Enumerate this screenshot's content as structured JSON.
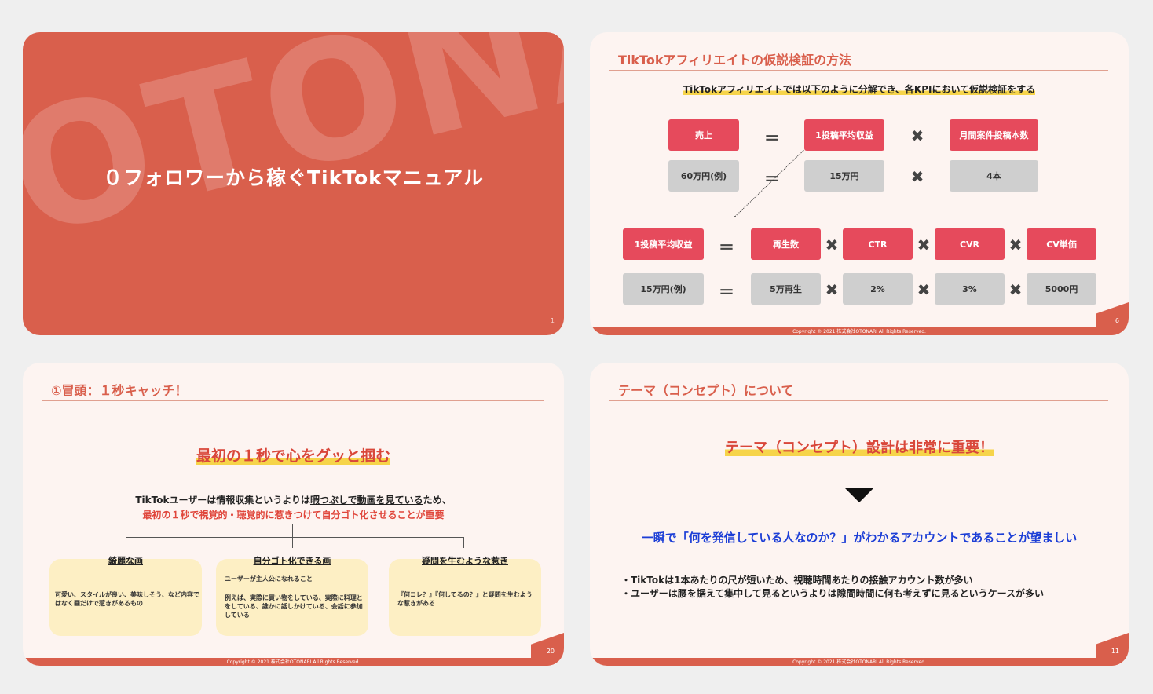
{
  "s1": {
    "watermark": "OTONARI",
    "title": "０フォロワーから稼ぐTikTokマニュアル",
    "page": "1"
  },
  "s2": {
    "title": "TikTokアフィリエイトの仮説検証の方法",
    "subtitle": "TikTokアフィリエイトでは以下のように分解でき、各KPIにおいて仮説検証をする",
    "row1": [
      "売上",
      "1投稿平均収益",
      "月間案件投稿本数"
    ],
    "row2": [
      "60万円(例)",
      "15万円",
      "4本"
    ],
    "row3": [
      "1投稿平均収益",
      "再生数",
      "CTR",
      "CVR",
      "CV単価"
    ],
    "row4": [
      "15万円(例)",
      "5万再生",
      "2%",
      "3%",
      "5000円"
    ],
    "equals": "＝",
    "times": "✖",
    "copyright": "Copyright © 2021 株式会社OTONARI All Rights Reserved.",
    "page": "6"
  },
  "s3": {
    "title": "①冒頭：１秒キャッチ！",
    "catch": "最初の１秒で心をグッと掴む",
    "line1_a": "TikTokユーザーは情報収集というよりは",
    "line1_u": "暇つぶしで動画を見ている",
    "line1_b": "ため、",
    "line2": "最初の１秒で視覚的・聴覚的に惹きつけて自分ゴト化させることが重要",
    "cards": [
      {
        "head": "綺麗な画",
        "text": "可愛い、スタイルが良い、美味しそう、など内容ではなく画だけで惹きがあるもの"
      },
      {
        "head": "自分ゴト化できる画",
        "text1": "ユーザーが主人公になれること",
        "text2": "例えば、実際に買い物をしている、実際に料理とをしている、誰かに話しかけている、会話に参加している"
      },
      {
        "head": "疑問を生むような惹き",
        "text": "『何コレ？』『何してるの？』と疑問を生むような惹きがある"
      }
    ],
    "copyright": "Copyright © 2021 株式会社OTONARI All Rights Reserved.",
    "page": "20"
  },
  "s4": {
    "title": "テーマ（コンセプト）について",
    "catch": "テーマ（コンセプト）設計は非常に重要！",
    "main": "一瞬で「何を発信している人なのか？」がわかるアカウントであることが望ましい",
    "bullet1": "・TikTokは1本あたりの尺が短いため、視聴時間あたりの接触アカウント数が多い",
    "bullet2": "・ユーザーは腰を据えて集中して見るというよりは隙間時間に何も考えずに見るというケースが多い",
    "copyright": "Copyright © 2021 株式会社OTONARI All Rights Reserved.",
    "page": "11"
  }
}
